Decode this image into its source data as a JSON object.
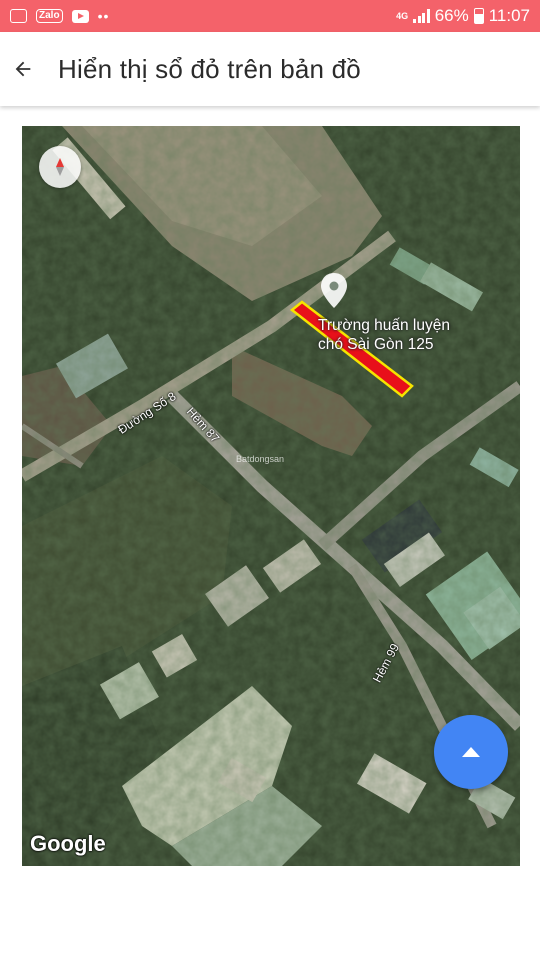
{
  "status_bar": {
    "network": "4G",
    "battery": "66%",
    "time": "11:07",
    "left_icons": [
      "gallery-icon",
      "zalo-icon",
      "youtube-icon",
      "more-dots-icon"
    ],
    "zalo_label": "Zalo",
    "dots": "••"
  },
  "header": {
    "back_icon": "arrow-left-icon",
    "title": "Hiển thị sổ đỏ trên bản đồ"
  },
  "map": {
    "type": "satellite",
    "poi_label_line1": "Trường huấn luyện",
    "poi_label_line2": "chó Sài Gòn 125",
    "roads": {
      "duong_so_8": "Đường Số 8",
      "hem_87": "Hẻm 87",
      "hem_99": "Hẻm 99"
    },
    "watermark": "Batdongsan",
    "attribution": "Google",
    "land_plot_fill": "#e8101a",
    "land_plot_border": "#f5e400",
    "compass_icon": "compass-icon",
    "fab_icon": "caret-up-icon",
    "fab_color": "#4285f4"
  }
}
